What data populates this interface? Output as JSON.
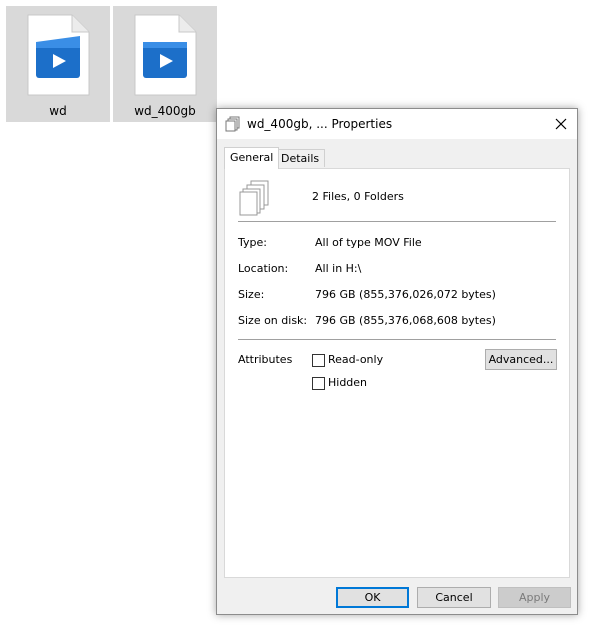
{
  "files": [
    {
      "name": "wd"
    },
    {
      "name": "wd_400gb"
    }
  ],
  "dialog": {
    "title": "wd_400gb, ... Properties",
    "tabs": [
      {
        "label": "General",
        "active": true
      },
      {
        "label": "Details",
        "active": false
      }
    ],
    "summary": "2 Files, 0 Folders",
    "details": [
      {
        "label": "Type:",
        "value": "All of type MOV File"
      },
      {
        "label": "Location:",
        "value": "All in H:\\"
      },
      {
        "label": "Size:",
        "value": "796 GB (855,376,026,072 bytes)"
      },
      {
        "label": "Size on disk:",
        "value": "796 GB (855,376,068,608 bytes)"
      }
    ],
    "attributes": {
      "label": "Attributes",
      "readonly": {
        "label": "Read-only",
        "checked": false
      },
      "hidden": {
        "label": "Hidden",
        "checked": false
      },
      "advanced_label": "Advanced..."
    },
    "buttons": {
      "ok": "OK",
      "cancel": "Cancel",
      "apply": "Apply"
    }
  },
  "colors": {
    "accent": "#0078d7",
    "tile_bg": "#d9d9d9",
    "icon_blue": "#1c6fc9"
  }
}
